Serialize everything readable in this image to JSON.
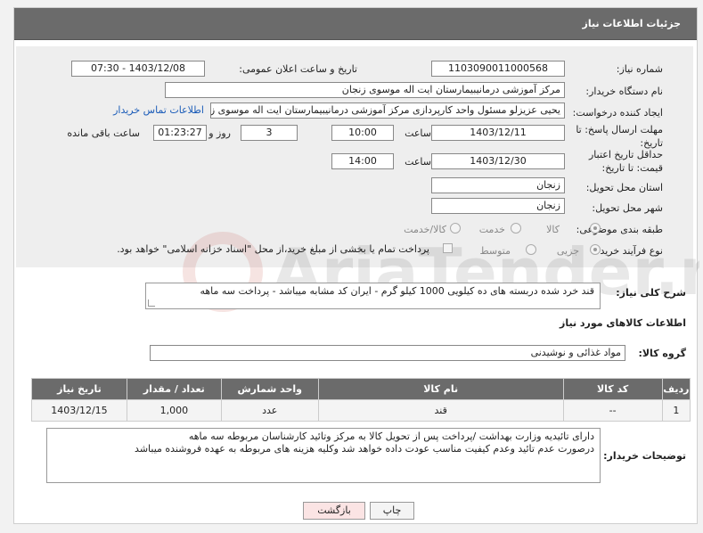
{
  "header": {
    "title": "جزئیات اطلاعات نیاز"
  },
  "form": {
    "need_number_label": "شماره نیاز:",
    "need_number": "1103090011000568",
    "announce_label": "تاریخ و ساعت اعلان عمومی:",
    "announce_value": "1403/12/08 - 07:30",
    "buyer_org_label": "نام دستگاه خریدار:",
    "buyer_org": "مرکز آموزشی درمانیبیمارستان ایت اله موسوی زنجان",
    "creator_label": "ایجاد کننده درخواست:",
    "creator": "یحیی عزیزلو مسئول واحد کارپردازی مرکز آموزشی درمانیبیمارستان ایت اله موسوی زنجان",
    "contact_link": "اطلاعات تماس خریدار",
    "deadline_label": "مهلت ارسال پاسخ: تا تاریخ:",
    "deadline_date": "1403/12/11",
    "time_label": "ساعت",
    "deadline_time": "10:00",
    "days_value": "3",
    "days_label": "روز و",
    "remaining_time": "01:23:27",
    "remaining_label": "ساعت باقی مانده",
    "validity_label": "حداقل تاریخ اعتبار قیمت: تا تاریخ:",
    "validity_date": "1403/12/30",
    "validity_time": "14:00",
    "province_label": "استان محل تحویل:",
    "province": "زنجان",
    "city_label": "شهر محل تحویل:",
    "city": "زنجان",
    "category_label": "طبقه بندی موضوعی:",
    "category_options": [
      "کالا",
      "خدمت",
      "کالا/خدمت"
    ],
    "process_label": "نوع فرآیند خرید :",
    "process_options": [
      "جزیی",
      "متوسط"
    ],
    "payment_note": "پرداخت تمام یا بخشی از مبلغ خرید،از محل \"اسناد خزانه اسلامی\" خواهد بود."
  },
  "description": {
    "label": "شرح کلی نیاز:",
    "text": "قند  خرد شده  دربسته های ده کیلویی  1000 کیلو گرم  - ایران کد مشابه میباشد - پرداخت سه  ماهه"
  },
  "goods": {
    "section_title": "اطلاعات کالاهای مورد نیاز",
    "group_label": "گروه کالا:",
    "group_value": "مواد غذائی و نوشیدنی"
  },
  "table": {
    "headers": [
      "ردیف",
      "کد کالا",
      "نام کالا",
      "واحد شمارش",
      "تعداد / مقدار",
      "تاریخ نیاز"
    ],
    "rows": [
      [
        "1",
        "--",
        "قند",
        "عدد",
        "1,000",
        "1403/12/15"
      ]
    ]
  },
  "buyer_notes": {
    "label": "توضیحات خریدار:",
    "line1": "دارای تائیدیه وزارت بهداشت /پرداخت پس از تحویل کالا به مرکز وتائید کارشناسان مربوطه سه ماهه",
    "line2": "درصورت عدم تائید وعدم کیفیت مناسب عودت داده خواهد شد وکلیه هزینه های مربوطه به عهده فروشنده میباشد"
  },
  "buttons": {
    "print": "چاپ",
    "back": "بازگشت"
  },
  "watermark_text": "AriaTender.net",
  "colors": {
    "header_bg": "#6b6b6b",
    "link": "#1a5bb8",
    "back_button_bg": "#fbe4e4"
  }
}
